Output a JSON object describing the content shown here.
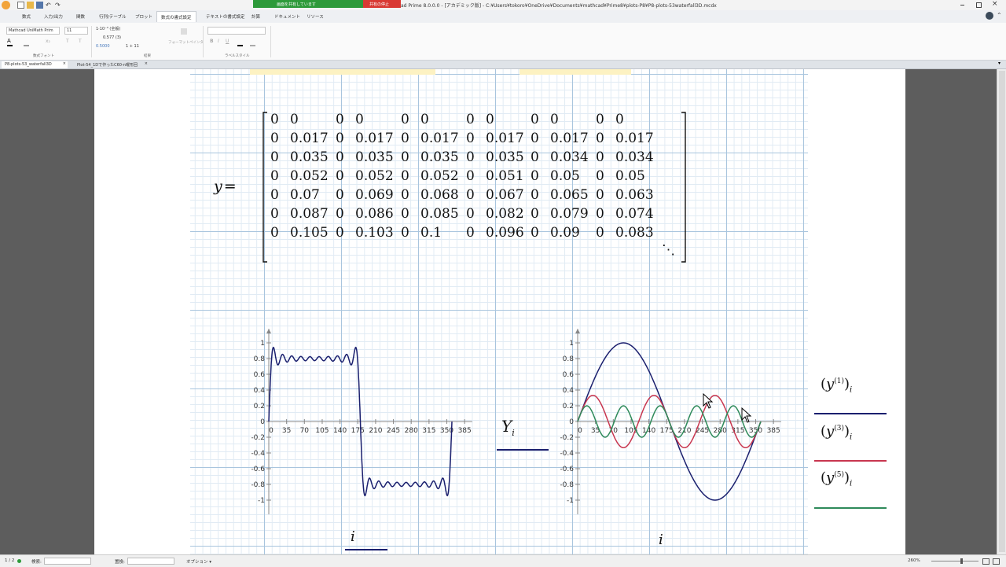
{
  "window": {
    "title": "ad Prime 8.0.0.0 - [アカデミック版] - C:¥Users¥tokoro¥OneDrive¥Documents¥mathcad¥Prime8¥plots-P8¥P8-plots-53waterfall3D.mcdx",
    "share_label": "画面を共有しています",
    "stop_share_label": "共有の停止"
  },
  "ribbon": {
    "tabs": [
      "数式",
      "入力/出力",
      "関数",
      "行列/テーブル",
      "プロット",
      "数式の書式設定",
      "テキストの書式設定",
      "計算",
      "ドキュメント",
      "リソース"
    ],
    "active_tab": "数式の書式設定",
    "font_name": "Mathcad UniMath Prim",
    "font_size": "11",
    "result_format": "1·10⁻³ (全般)",
    "precision": "0.577 (3)",
    "sample_value": "0.5000",
    "sample_expr": "1 + 11",
    "format_painter": "フォーマットペインタ",
    "group_math_font": "数式フォント",
    "group_result": "結果",
    "group_label_style": "ラベルスタイル"
  },
  "doc_tabs": [
    "P8-plots-53_waterfall3D",
    "Plot-54_1Dで作ったC60-n曜形回"
  ],
  "worksheet": {
    "y_label": "y",
    "equals": "=",
    "matrix": [
      [
        "0",
        "0",
        "0",
        "0",
        "0",
        "0",
        "0",
        "0",
        "0",
        "0",
        "0",
        "0"
      ],
      [
        "0",
        "0.017",
        "0",
        "0.017",
        "0",
        "0.017",
        "0",
        "0.017",
        "0",
        "0.017",
        "0",
        "0.017"
      ],
      [
        "0",
        "0.035",
        "0",
        "0.035",
        "0",
        "0.035",
        "0",
        "0.035",
        "0",
        "0.034",
        "0",
        "0.034"
      ],
      [
        "0",
        "0.052",
        "0",
        "0.052",
        "0",
        "0.052",
        "0",
        "0.051",
        "0",
        "0.05",
        "0",
        "0.05"
      ],
      [
        "0",
        "0.07",
        "0",
        "0.069",
        "0",
        "0.068",
        "0",
        "0.067",
        "0",
        "0.065",
        "0",
        "0.063"
      ],
      [
        "0",
        "0.087",
        "0",
        "0.086",
        "0",
        "0.085",
        "0",
        "0.082",
        "0",
        "0.079",
        "0",
        "0.074"
      ],
      [
        "0",
        "0.105",
        "0",
        "0.103",
        "0",
        "0.1",
        "0",
        "0.096",
        "0",
        "0.09",
        "0",
        "0.083"
      ]
    ],
    "ellipsis": "⋱"
  },
  "chart_data": [
    {
      "type": "line",
      "x_ticks": [
        "0",
        "35",
        "70",
        "105",
        "140",
        "175",
        "210",
        "245",
        "280",
        "315",
        "350",
        "385"
      ],
      "y_ticks": [
        "1",
        "0.8",
        "0.6",
        "0.4",
        "0.2",
        "0",
        "-0.2",
        "-0.4",
        "-0.6",
        "-0.8",
        "-1"
      ],
      "xlim": [
        0,
        400
      ],
      "ylim": [
        -1.1,
        1.1
      ],
      "xlabel": "i",
      "ylabel": "Y",
      "ylabel_sub": "i",
      "series": [
        {
          "color": "#1a1f6e",
          "description": "Square-wave Fourier approximation: +0.8 with ripple on 0–180, −0.8 with ripple on 180–360, Gibbs overshoot ≈0.92 at edges",
          "x": [
            0,
            2,
            5,
            10,
            30,
            60,
            90,
            120,
            150,
            170,
            175,
            178,
            180,
            182,
            185,
            190,
            210,
            240,
            270,
            300,
            330,
            350,
            355,
            358,
            360
          ],
          "y": [
            0,
            0.6,
            0.92,
            0.78,
            0.8,
            0.8,
            0.8,
            0.8,
            0.8,
            0.78,
            0.92,
            0.6,
            0,
            -0.6,
            -0.92,
            -0.78,
            -0.8,
            -0.8,
            -0.8,
            -0.8,
            -0.8,
            -0.78,
            -0.92,
            -0.6,
            0
          ]
        }
      ]
    },
    {
      "type": "line",
      "x_ticks": [
        "0",
        "35",
        "70",
        "105",
        "140",
        "175",
        "210",
        "245",
        "280",
        "315",
        "350",
        "385"
      ],
      "y_ticks": [
        "1",
        "0.8",
        "0.6",
        "0.4",
        "0.2",
        "0",
        "-0.2",
        "-0.4",
        "-0.6",
        "-0.8",
        "-1"
      ],
      "xlim": [
        0,
        400
      ],
      "ylim": [
        -1.1,
        1.1
      ],
      "xlabel": "i",
      "series": [
        {
          "name": "(y⁽¹⁾)ᵢ",
          "color": "#1a1f6e",
          "amplitude": 1,
          "harmonic": 1
        },
        {
          "name": "(y⁽³⁾)ᵢ",
          "color": "#c8364f",
          "amplitude": 0.333,
          "harmonic": 3
        },
        {
          "name": "(y⁽⁵⁾)ᵢ",
          "color": "#2e8a5a",
          "amplitude": 0.2,
          "harmonic": 5
        }
      ]
    }
  ],
  "legend": [
    {
      "base": "y",
      "sup": "(1)",
      "sub": "i",
      "color": "#1a1f6e"
    },
    {
      "base": "y",
      "sup": "(3)",
      "sub": "i",
      "color": "#c8364f"
    },
    {
      "base": "y",
      "sup": "(5)",
      "sub": "i",
      "color": "#2e8a5a"
    }
  ],
  "status": {
    "page": "1 / 2",
    "search_label": "検索:",
    "replace_label": "置換:",
    "options_label": "オプション ▾",
    "zoom": "260%"
  }
}
